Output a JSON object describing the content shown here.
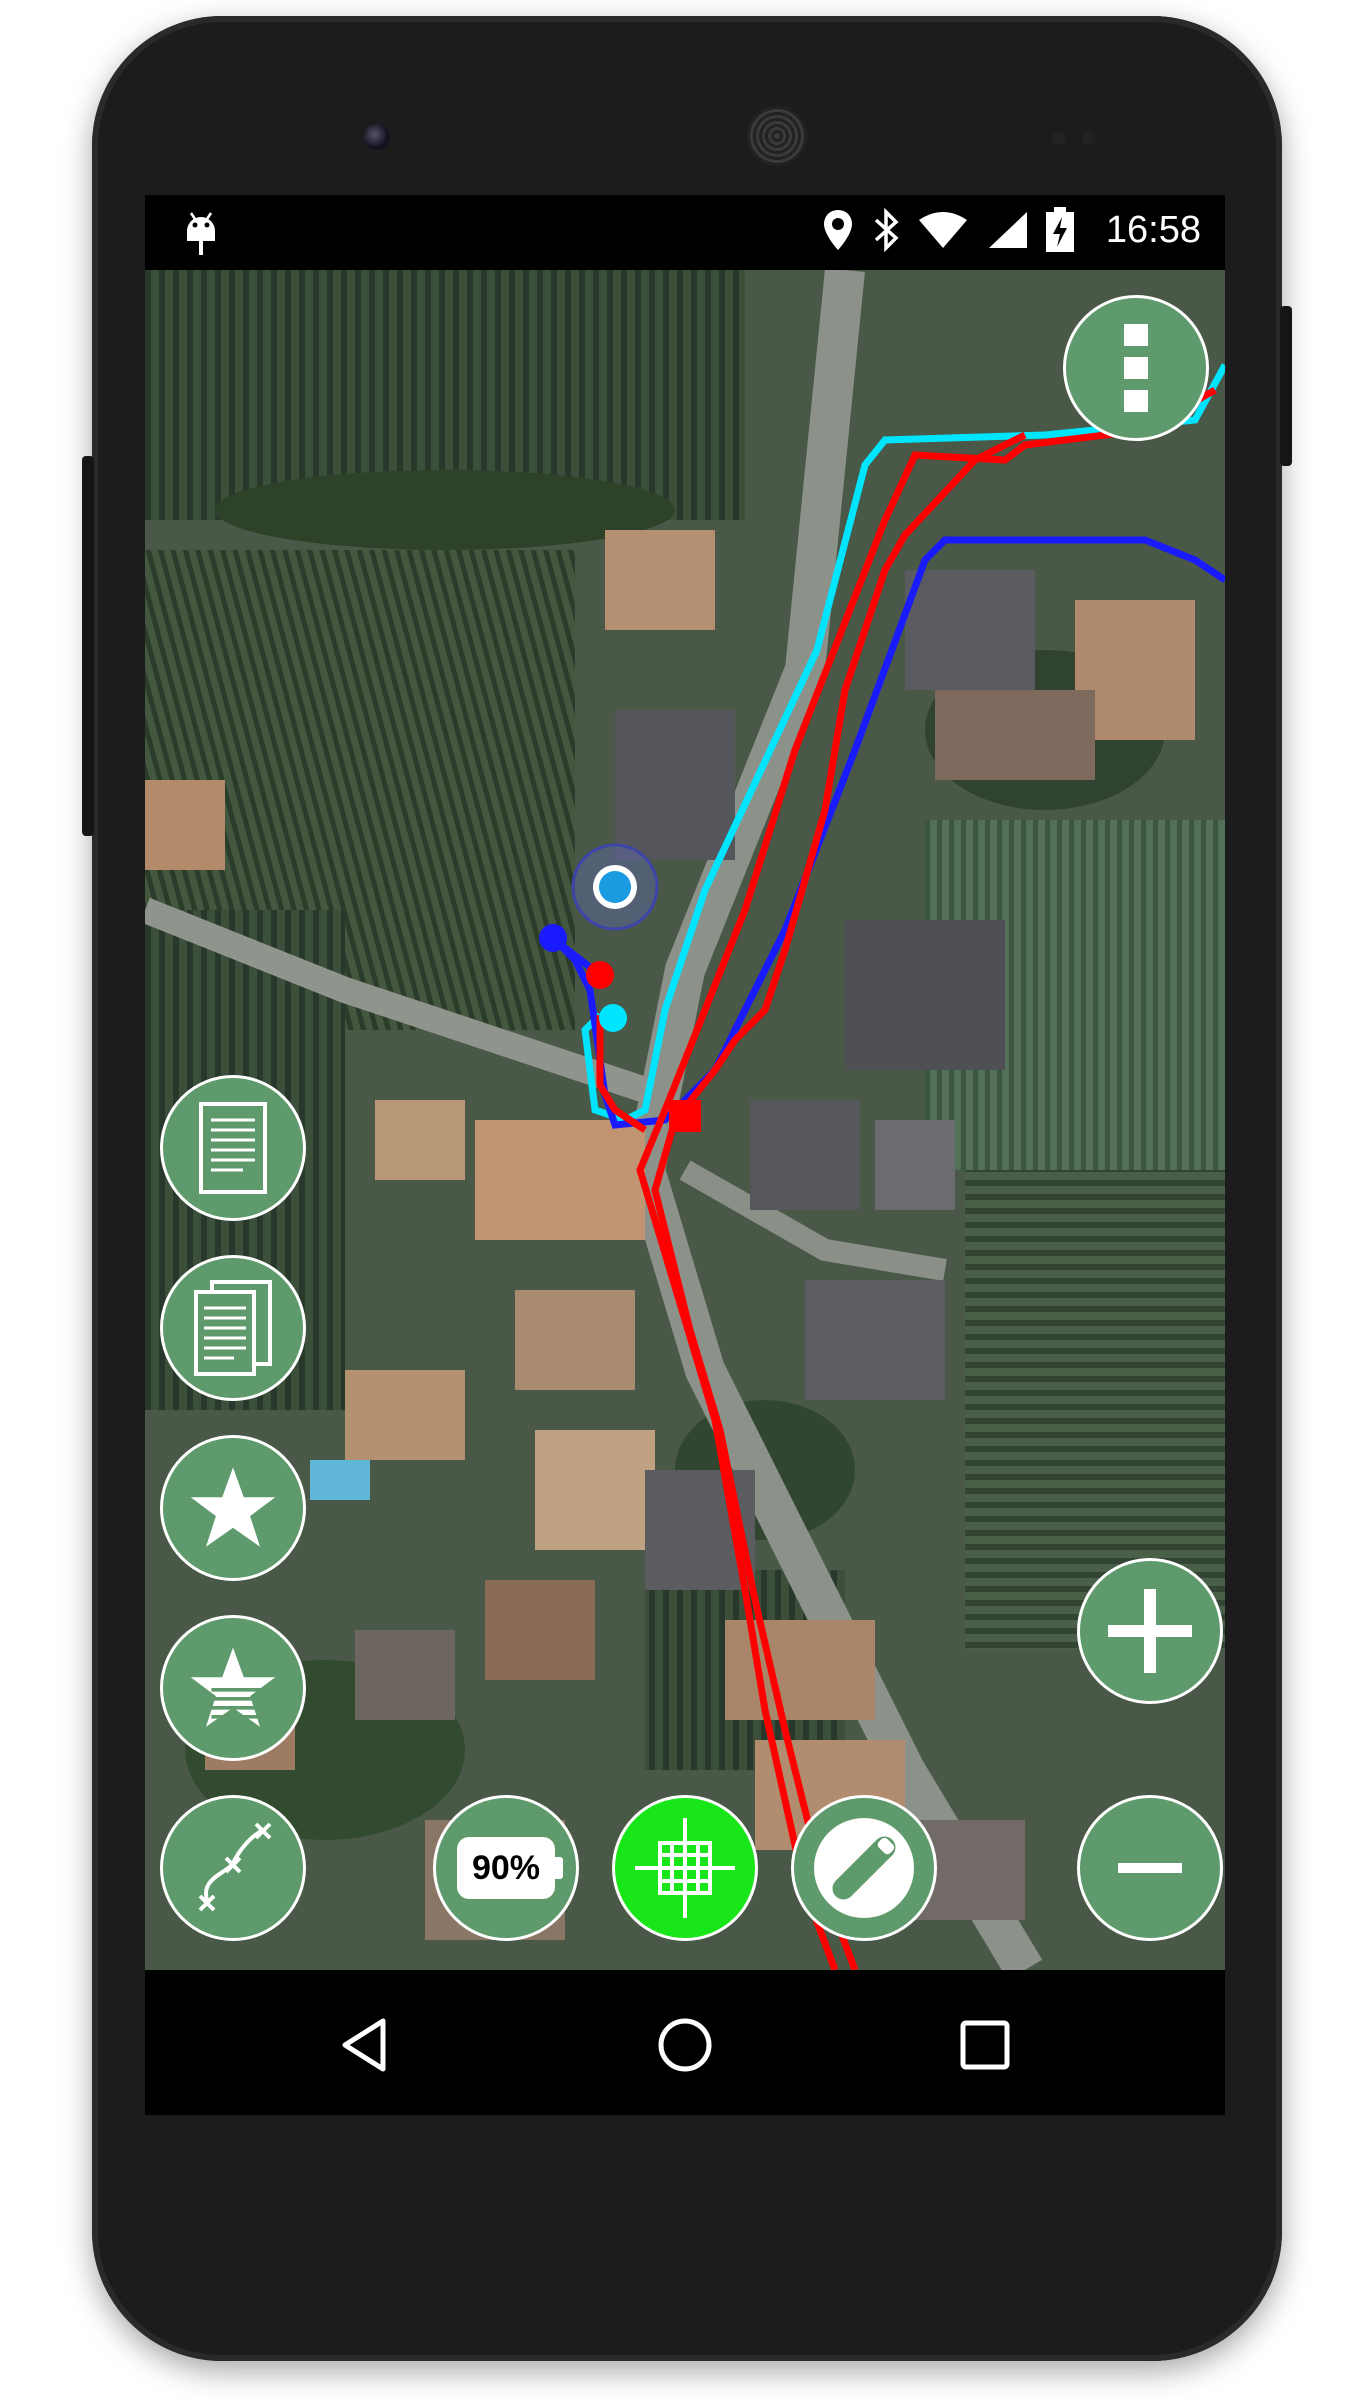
{
  "status_bar": {
    "time": "16:58",
    "icons": [
      "android-debug-icon",
      "location-icon",
      "bluetooth-icon",
      "wifi-icon",
      "cell-signal-icon",
      "battery-charging-icon"
    ]
  },
  "map": {
    "type": "satellite",
    "zoom_level": "19",
    "tracks": [
      {
        "color": "#00e5ff"
      },
      {
        "color": "#1a1aff"
      },
      {
        "color": "#ff0000"
      }
    ]
  },
  "controls": {
    "battery_indicator": "90%",
    "left_buttons": [
      "notes-icon",
      "notes-list-icon",
      "star-icon",
      "star-list-icon",
      "draw-line-icon"
    ],
    "bottom_buttons": [
      "battery-indicator",
      "gps-center-icon",
      "pencil-icon"
    ],
    "right_buttons": [
      "menu-icon",
      "zoom-in-icon",
      "zoom-out-icon"
    ]
  },
  "colors": {
    "button_fill": "#5e9a6c",
    "gps_button": "#19e619",
    "track_cyan": "#00e5ff",
    "track_blue": "#1a1aff",
    "track_red": "#ff0000"
  }
}
